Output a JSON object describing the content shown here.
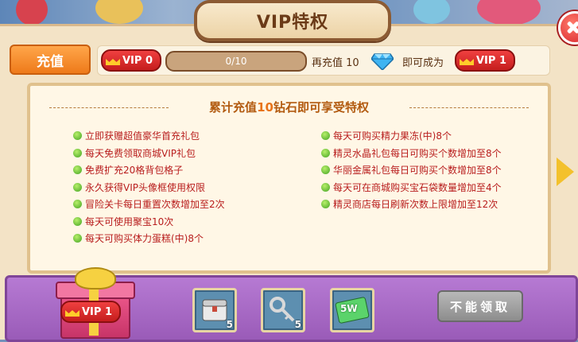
{
  "window": {
    "title": "VIP特权"
  },
  "topbar": {
    "recharge_label": "充值",
    "current_vip": "VIP 0",
    "progress_text": "0/10",
    "progress_fraction": 0,
    "text_recharge_prefix": "再充值",
    "recharge_amount": "10",
    "diamond_icon": "diamond-icon",
    "text_become": "即可成为",
    "next_vip": "VIP 1"
  },
  "panel": {
    "header_prefix": "累计充值",
    "header_amount": "10",
    "header_suffix": "钻石即可享受特权",
    "left_perks": [
      "立即获赠超值豪华首充礼包",
      "每天免费领取商城VIP礼包",
      "免费扩充20格背包格子",
      "永久获得VIP头像框使用权限",
      "冒险关卡每日重置次数增加至2次",
      "每天可使用聚宝10次",
      "每天可购买体力蛋糕(中)8个"
    ],
    "right_perks": [
      "每天可购买精力果冻(中)8个",
      "精灵水晶礼包每日可购买个数增加至8个",
      "华丽金属礼包每日可购买个数增加至8个",
      "每天可在商城购买宝石袋数量增加至4个",
      "精灵商店每日刷新次数上限增加至12次"
    ]
  },
  "reward": {
    "gift_vip": "VIP 1",
    "items": [
      {
        "icon": "chest-icon",
        "count": "5"
      },
      {
        "icon": "key-icon",
        "count": "5"
      },
      {
        "icon": "energy-card-icon",
        "label": "5W"
      }
    ],
    "claim_label": "不能领取"
  },
  "colors": {
    "accent": "#ee7a1a",
    "perk_text": "#b81d1d",
    "highlight": "#e8741a"
  }
}
